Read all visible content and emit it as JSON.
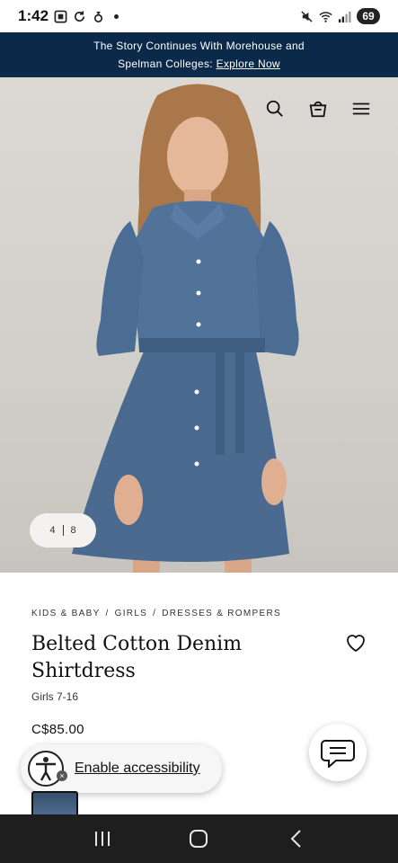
{
  "status_bar": {
    "time": "1:42",
    "battery": "69"
  },
  "promo": {
    "line1": "The Story Continues With Morehouse and",
    "line2_prefix": "Spelman Colleges:",
    "link": "Explore Now"
  },
  "header_icons": [
    "search-icon",
    "shopping-bag-icon",
    "menu-icon"
  ],
  "gallery": {
    "current": "4",
    "total": "8"
  },
  "breadcrumb": {
    "items": [
      "KIDS & BABY",
      "GIRLS",
      "DRESSES & ROMPERS"
    ],
    "separator": "/"
  },
  "product": {
    "title_line1": "Belted Cotton Denim",
    "title_line2": "Shirtdress",
    "subtitle": "Girls 7-16",
    "price": "C$85.00"
  },
  "accessibility": {
    "label": "Enable accessibility"
  },
  "colors": {
    "promo_bg": "#0b2a4a",
    "denim": "#4a6a8f",
    "navbar_bg": "#1e1e1e"
  }
}
